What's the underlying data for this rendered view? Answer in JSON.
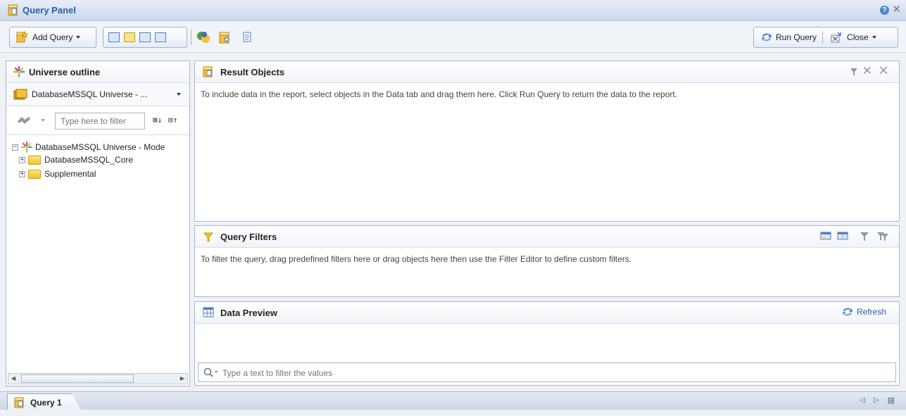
{
  "window": {
    "title": "Query Panel"
  },
  "toolbar": {
    "add_query": "Add Query",
    "run_query": "Run Query",
    "close": "Close"
  },
  "left_panel": {
    "title": "Universe outline",
    "universe_selector": "DatabaseMSSQL Universe - ...",
    "filter_placeholder": "Type here to filter",
    "tree": {
      "root": "DatabaseMSSQL Universe - Mode",
      "children": [
        "DatabaseMSSQL_Core",
        "Supplemental"
      ]
    }
  },
  "result_objects": {
    "title": "Result Objects",
    "description": "To include data in the report, select objects in the Data tab and drag them here. Click Run Query to return the data to the report."
  },
  "query_filters": {
    "title": "Query Filters",
    "description": "To filter the query, drag predefined filters here or drag objects here then use the Filter Editor to define custom filters."
  },
  "data_preview": {
    "title": "Data Preview",
    "refresh": "Refresh",
    "filter_placeholder": "Type a text to filter the values"
  },
  "tabs": [
    {
      "label": "Query 1"
    }
  ],
  "colors": {
    "accent": "#2a5fa8",
    "border": "#a9b7cc"
  }
}
